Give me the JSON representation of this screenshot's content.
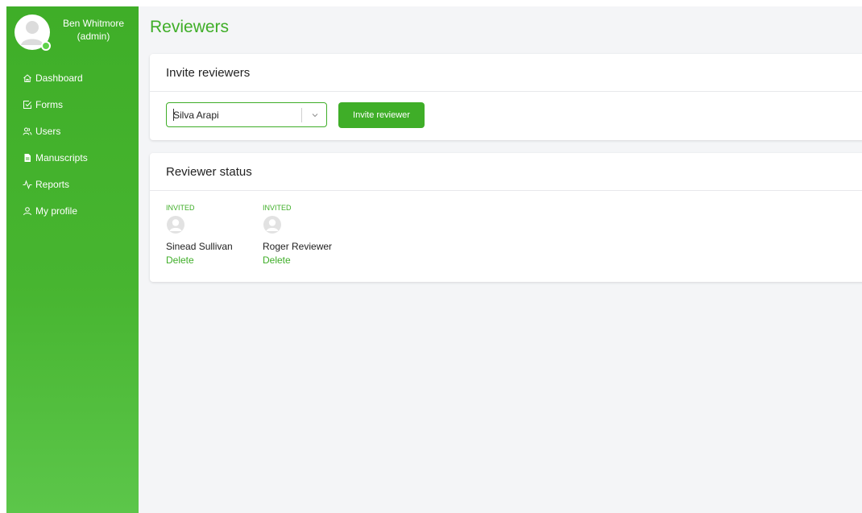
{
  "user": {
    "name": "Ben Whitmore",
    "role": "(admin)"
  },
  "sidebar": {
    "items": [
      {
        "label": "Dashboard",
        "icon": "home-icon"
      },
      {
        "label": "Forms",
        "icon": "checkbox-icon"
      },
      {
        "label": "Users",
        "icon": "users-icon"
      },
      {
        "label": "Manuscripts",
        "icon": "document-icon"
      },
      {
        "label": "Reports",
        "icon": "activity-icon"
      },
      {
        "label": "My profile",
        "icon": "user-icon"
      }
    ]
  },
  "page": {
    "title": "Reviewers"
  },
  "invite": {
    "heading": "Invite reviewers",
    "selected_reviewer": "Silva Arapi",
    "button_label": "Invite reviewer"
  },
  "status": {
    "heading": "Reviewer status",
    "reviewers": [
      {
        "status": "INVITED",
        "name": "Sinead Sullivan",
        "action": "Delete"
      },
      {
        "status": "INVITED",
        "name": "Roger Reviewer",
        "action": "Delete"
      }
    ]
  },
  "colors": {
    "accent": "#3fae28",
    "sidebar_bottom": "#5cc64a",
    "background": "#f4f5f7"
  }
}
